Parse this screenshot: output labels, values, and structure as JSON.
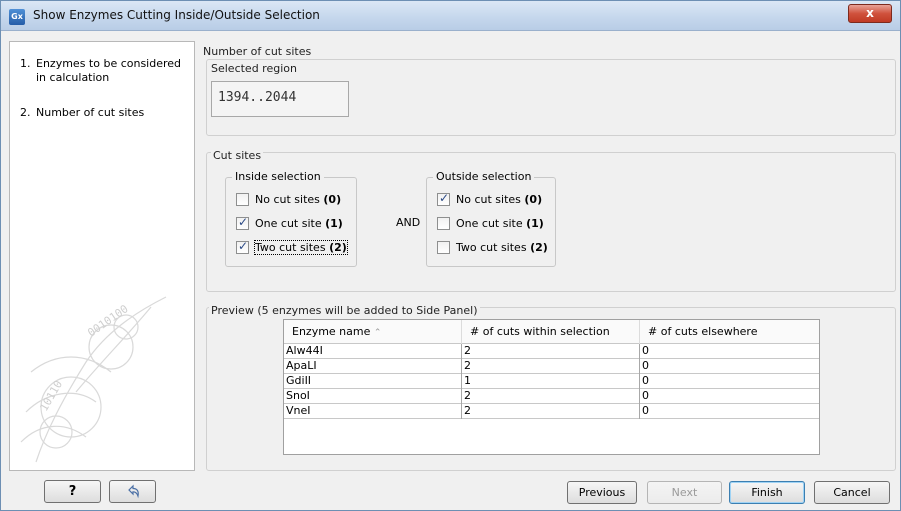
{
  "window": {
    "title": "Show Enzymes Cutting Inside/Outside Selection",
    "app_icon_text": "Gx",
    "close_label": "x"
  },
  "steps": [
    {
      "num": "1.",
      "label": "Enzymes to be considered in calculation"
    },
    {
      "num": "2.",
      "label": "Number of cut sites"
    }
  ],
  "main": {
    "heading": "Number of cut sites",
    "selected_region": {
      "title": "Selected region",
      "value": "1394..2044"
    },
    "cut_sites": {
      "title": "Cut sites",
      "and_label": "AND",
      "inside": {
        "title": "Inside selection",
        "options": [
          {
            "label": "No cut sites",
            "count": "(0)",
            "checked": false
          },
          {
            "label": "One cut site",
            "count": "(1)",
            "checked": true
          },
          {
            "label": "Two cut sites",
            "count": "(2)",
            "checked": true
          }
        ]
      },
      "outside": {
        "title": "Outside selection",
        "options": [
          {
            "label": "No cut sites",
            "count": "(0)",
            "checked": true
          },
          {
            "label": "One cut site",
            "count": "(1)",
            "checked": false
          },
          {
            "label": "Two cut sites",
            "count": "(2)",
            "checked": false
          }
        ]
      }
    },
    "preview": {
      "title": "Preview (5 enzymes will be added to Side Panel)",
      "columns": [
        "Enzyme name",
        "# of cuts within selection",
        "# of cuts elsewhere"
      ],
      "sort_indicator": "⌃",
      "rows": [
        [
          "Alw44I",
          "2",
          "0"
        ],
        [
          "ApaLI",
          "2",
          "0"
        ],
        [
          "GdiII",
          "1",
          "0"
        ],
        [
          "SnoI",
          "2",
          "0"
        ],
        [
          "VneI",
          "2",
          "0"
        ]
      ]
    }
  },
  "footer": {
    "help_label": "?",
    "reset_icon": "undo-arrow-icon",
    "previous_label": "Previous",
    "next_label": "Next",
    "finish_label": "Finish",
    "cancel_label": "Cancel"
  }
}
